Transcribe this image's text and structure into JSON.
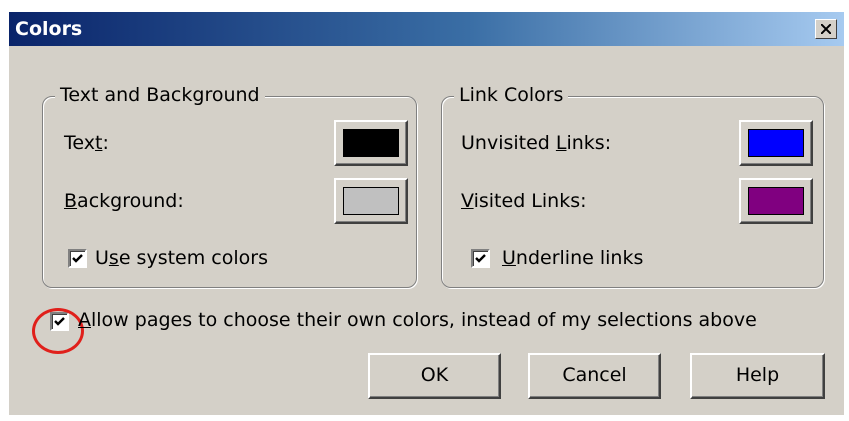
{
  "window": {
    "title": "Colors",
    "close_label": "X"
  },
  "text_background_group": {
    "legend": "Text and Background",
    "text_label": {
      "pre": "Tex",
      "mnemonic": "t",
      "post": ":"
    },
    "text_color": "#000000",
    "background_label": {
      "pre": "",
      "mnemonic": "B",
      "post": "ackground:"
    },
    "background_color": "#c0c0c0",
    "use_system_colors": {
      "pre": "U",
      "mnemonic": "s",
      "post": "e system colors",
      "checked": true
    }
  },
  "link_colors_group": {
    "legend": "Link Colors",
    "unvisited_label": {
      "pre": "Unvisited ",
      "mnemonic": "L",
      "post": "inks:"
    },
    "unvisited_color": "#0000ff",
    "visited_label": {
      "pre": "",
      "mnemonic": "V",
      "post": "isited Links:"
    },
    "visited_color": "#800080",
    "underline_links": {
      "pre": "",
      "mnemonic": "U",
      "post": "nderline links",
      "checked": true
    }
  },
  "allow_pages_colors": {
    "pre": "",
    "mnemonic": "A",
    "post": "llow pages to choose their own colors, instead of my selections above",
    "checked": true,
    "highlight_color": "#e0201b"
  },
  "buttons": {
    "ok": "OK",
    "cancel": "Cancel",
    "help": "Help"
  },
  "colors": {
    "dialog_bg": "#d4d0c8",
    "title_start": "#0a246a",
    "title_end": "#a6caf0"
  }
}
